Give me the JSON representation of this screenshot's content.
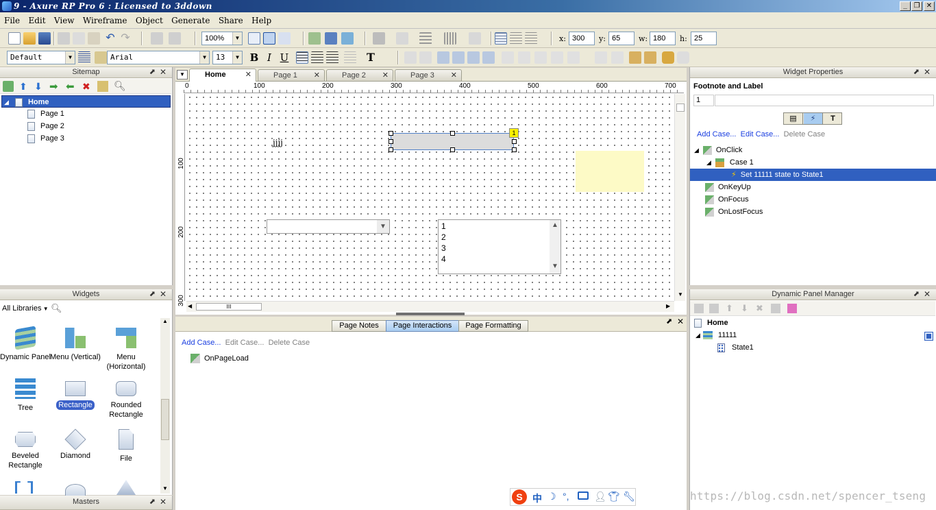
{
  "window": {
    "title": "9 - Axure RP Pro 6 : Licensed to 3ddown",
    "minimize": "_",
    "restore": "❐",
    "close": "✕"
  },
  "menu": [
    "File",
    "Edit",
    "View",
    "Wireframe",
    "Object",
    "Generate",
    "Share",
    "Help"
  ],
  "toolbar1": {
    "zoom": "100%",
    "x_label": "x:",
    "x": "300",
    "y_label": "y:",
    "y": "65",
    "w_label": "w:",
    "w": "180",
    "h_label": "h:",
    "h": "25"
  },
  "toolbar2": {
    "style": "Default",
    "font": "Arial",
    "size": "13",
    "bold": "B",
    "italic": "I",
    "underline": "U",
    "text_tool": "T"
  },
  "sitemap": {
    "title": "Sitemap",
    "items": [
      {
        "label": "Home"
      },
      {
        "label": "Page 1"
      },
      {
        "label": "Page 2"
      },
      {
        "label": "Page 3"
      }
    ]
  },
  "widgets": {
    "title": "Widgets",
    "library": "All Libraries",
    "items": [
      {
        "label": "Dynamic Panel"
      },
      {
        "label": "Menu (Vertical)"
      },
      {
        "label": "Menu (Horizontal)"
      },
      {
        "label": "Tree"
      },
      {
        "label": "Rectangle"
      },
      {
        "label": "Rounded Rectangle"
      },
      {
        "label": "Beveled Rectangle"
      },
      {
        "label": "Diamond"
      },
      {
        "label": "File"
      }
    ]
  },
  "masters": {
    "title": "Masters"
  },
  "tabs": [
    {
      "label": "Home"
    },
    {
      "label": "Page 1"
    },
    {
      "label": "Page 2"
    },
    {
      "label": "Page 3"
    }
  ],
  "ruler": {
    "h": [
      "0",
      "100",
      "200",
      "300",
      "400",
      "500",
      "600",
      "700"
    ],
    "v": [
      "100",
      "200",
      "300"
    ]
  },
  "canvas": {
    "text_widget": "jjjj",
    "footnote": "1",
    "listbox_items": [
      "1",
      "2",
      "3",
      "4"
    ],
    "hscroll_grip": "III"
  },
  "bottom_panel": {
    "tabs": [
      "Page Notes",
      "Page Interactions",
      "Page Formatting"
    ],
    "add_case": "Add Case...",
    "edit_case": "Edit Case...",
    "delete_case": "Delete Case",
    "event": "OnPageLoad"
  },
  "widget_properties": {
    "title": "Widget Properties",
    "section": "Footnote and Label",
    "footnote_value": "1",
    "label_value": "",
    "add_case": "Add Case...",
    "edit_case": "Edit Case...",
    "delete_case": "Delete Case",
    "events": [
      {
        "label": "OnClick"
      },
      {
        "label": "Case 1"
      },
      {
        "label": "Set 11111 state to State1"
      },
      {
        "label": "OnKeyUp"
      },
      {
        "label": "OnFocus"
      },
      {
        "label": "OnLostFocus"
      }
    ]
  },
  "dynamic_panel_manager": {
    "title": "Dynamic Panel Manager",
    "items": [
      {
        "label": "Home"
      },
      {
        "label": "11111"
      },
      {
        "label": "State1"
      }
    ]
  },
  "watermark": "https://blog.csdn.net/spencer_tseng",
  "ime": {
    "zh": "中"
  }
}
